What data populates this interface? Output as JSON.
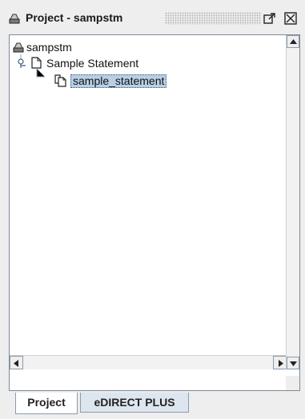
{
  "titlebar": {
    "title": "Project - sampstm",
    "icon": "project-icon",
    "float_icon": "undock-icon",
    "close_icon": "close-icon"
  },
  "tree": {
    "nodes": [
      {
        "label": "sampstm",
        "icon": "project-icon",
        "level": 0
      },
      {
        "label": "Sample Statement",
        "icon": "document-icon",
        "level": 1,
        "expanded": true
      },
      {
        "label": "sample_statement",
        "icon": "copy-document-icon",
        "level": 2,
        "selected": true
      }
    ]
  },
  "scrollbars": {
    "vertical_up": "scroll-up-arrow-icon",
    "vertical_down": "scroll-down-arrow-icon",
    "horizontal_left": "scroll-left-arrow-icon",
    "horizontal_right": "scroll-right-arrow-icon"
  },
  "tabs": [
    {
      "label": "Project",
      "active": true
    },
    {
      "label": "eDIRECT PLUS",
      "active": false
    }
  ],
  "colors": {
    "selection": "#b8cfe5",
    "background": "#eeeeee"
  }
}
